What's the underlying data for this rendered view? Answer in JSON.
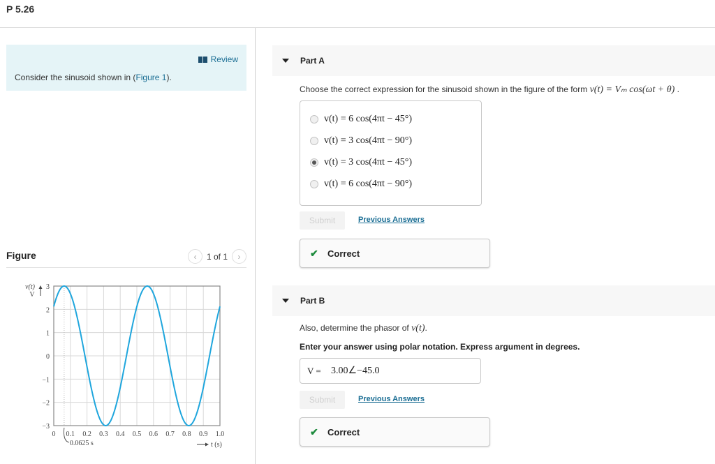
{
  "problem": {
    "title": "P 5.26"
  },
  "intro": {
    "review_label": "Review",
    "text_before": "Consider the sinusoid shown in (",
    "figure_link": "Figure 1",
    "text_after": ")."
  },
  "figure": {
    "heading": "Figure",
    "pager": "1 of 1",
    "prev_icon": "‹",
    "next_icon": "›"
  },
  "chart_data": {
    "type": "line",
    "title": "",
    "ylabel": "v(t)",
    "yunit": "V",
    "xlabel": "t (s)",
    "xlim": [
      0,
      1.0
    ],
    "ylim": [
      -3,
      3
    ],
    "xticks": [
      "0",
      "0.1",
      "0.2",
      "0.3",
      "0.4",
      "0.5",
      "0.6",
      "0.7",
      "0.8",
      "0.9",
      "1.0"
    ],
    "yticks": [
      "3",
      "2",
      "1",
      "0",
      "−1",
      "−2",
      "−3"
    ],
    "grid": true,
    "annotation": "0.0625 s",
    "annotation_x": 0.0625,
    "series": [
      {
        "name": "v(t)",
        "function": "3cos(4πt − 45°)",
        "amplitude": 3,
        "frequency_hz": 2,
        "phase_deg": -45,
        "color": "#1fa6dd"
      }
    ]
  },
  "partA": {
    "label": "Part A",
    "question": "Choose the correct expression for the sinusoid shown in the figure of the form ",
    "question_math": "v(t) = Vₘ cos(ωt + θ)",
    "question_end": " .",
    "options": [
      {
        "text": "v(t) = 6 cos(4πt − 45°)",
        "selected": false
      },
      {
        "text": "v(t) = 3 cos(4πt − 90°)",
        "selected": false
      },
      {
        "text": "v(t) = 3 cos(4πt − 45°)",
        "selected": true
      },
      {
        "text": "v(t) = 6 cos(4πt − 90°)",
        "selected": false
      }
    ],
    "submit_label": "Submit",
    "previous_answers_label": "Previous Answers",
    "feedback": "Correct"
  },
  "partB": {
    "label": "Part B",
    "question": "Also, determine the phasor of ",
    "question_math": "v(t)",
    "question_end": ".",
    "instruction": "Enter your answer using polar notation. Express argument in degrees.",
    "answer_label": "V =",
    "answer_value": "3.00∠−45.0",
    "submit_label": "Submit",
    "previous_answers_label": "Previous Answers",
    "feedback": "Correct"
  },
  "colors": {
    "accent": "#1b6e94",
    "correct_green": "#1c8a3c",
    "intro_bg": "#e5f4f7",
    "curve": "#1fa6dd"
  }
}
